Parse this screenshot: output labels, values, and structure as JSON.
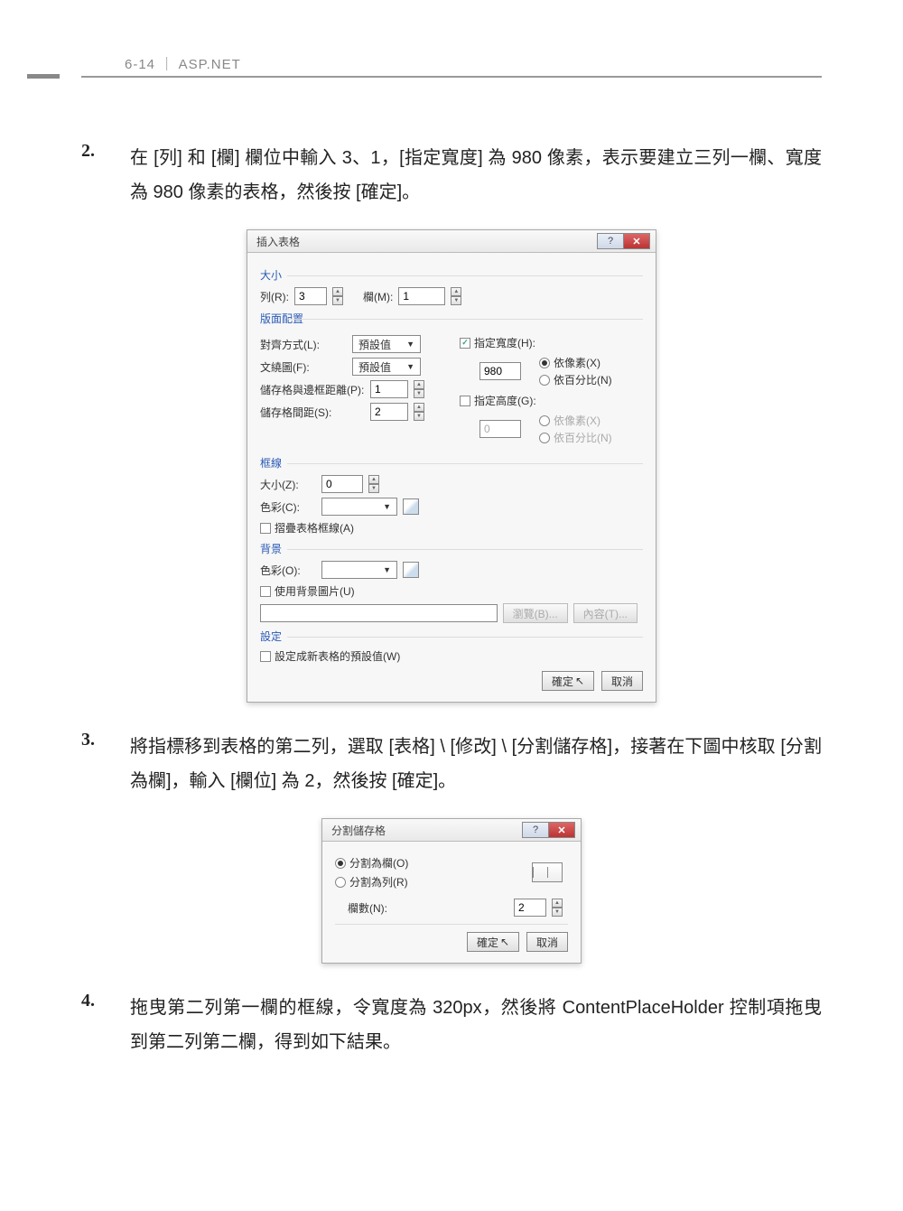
{
  "header": {
    "page_prefix": "6-14",
    "divider": "｜",
    "title": "ASP.NET"
  },
  "steps": {
    "s2": {
      "num": "2.",
      "text": "在 [列] 和 [欄] 欄位中輸入 3、1，[指定寬度] 為 980 像素，表示要建立三列一欄、寬度為 980 像素的表格，然後按 [確定]。"
    },
    "s3": {
      "num": "3.",
      "text": "將指標移到表格的第二列，選取 [表格] \\ [修改] \\ [分割儲存格]，接著在下圖中核取 [分割為欄]，輸入 [欄位] 為 2，然後按 [確定]。"
    },
    "s4": {
      "num": "4.",
      "text": "拖曳第二列第一欄的框線，令寬度為 320px，然後將 ContentPlaceHolder 控制項拖曳到第二列第二欄，得到如下結果。"
    }
  },
  "dialog1": {
    "title": "插入表格",
    "group_size": "大小",
    "rows_label": "列(R):",
    "rows_value": "3",
    "cols_label": "欄(M):",
    "cols_value": "1",
    "group_layout": "版面配置",
    "align_label": "對齊方式(L):",
    "align_value": "預設值",
    "float_label": "文繞圖(F):",
    "float_value": "預設值",
    "pad_label": "儲存格與邊框距離(P):",
    "pad_value": "1",
    "spacing_label": "儲存格間距(S):",
    "spacing_value": "2",
    "spec_width_label": "指定寬度(H):",
    "spec_width_checked": true,
    "width_value": "980",
    "width_px_label": "依像素(X)",
    "width_pct_label": "依百分比(N)",
    "spec_height_label": "指定高度(G):",
    "height_value": "0",
    "height_px_label": "依像素(X)",
    "height_pct_label": "依百分比(N)",
    "group_border": "框線",
    "border_size_label": "大小(Z):",
    "border_size_value": "0",
    "border_color_label": "色彩(C):",
    "collapse_label": "摺疊表格框線(A)",
    "group_bg": "背景",
    "bg_color_label": "色彩(O):",
    "bg_img_label": "使用背景圖片(U)",
    "browse_btn": "瀏覽(B)...",
    "content_btn": "內容(T)...",
    "group_setting": "設定",
    "default_label": "設定成新表格的預設值(W)",
    "ok_btn": "確定",
    "cancel_btn": "取消"
  },
  "dialog2": {
    "title": "分割儲存格",
    "split_col_label": "分割為欄(O)",
    "split_row_label": "分割為列(R)",
    "count_label": "欄數(N):",
    "count_value": "2",
    "ok_btn": "確定",
    "cancel_btn": "取消"
  }
}
